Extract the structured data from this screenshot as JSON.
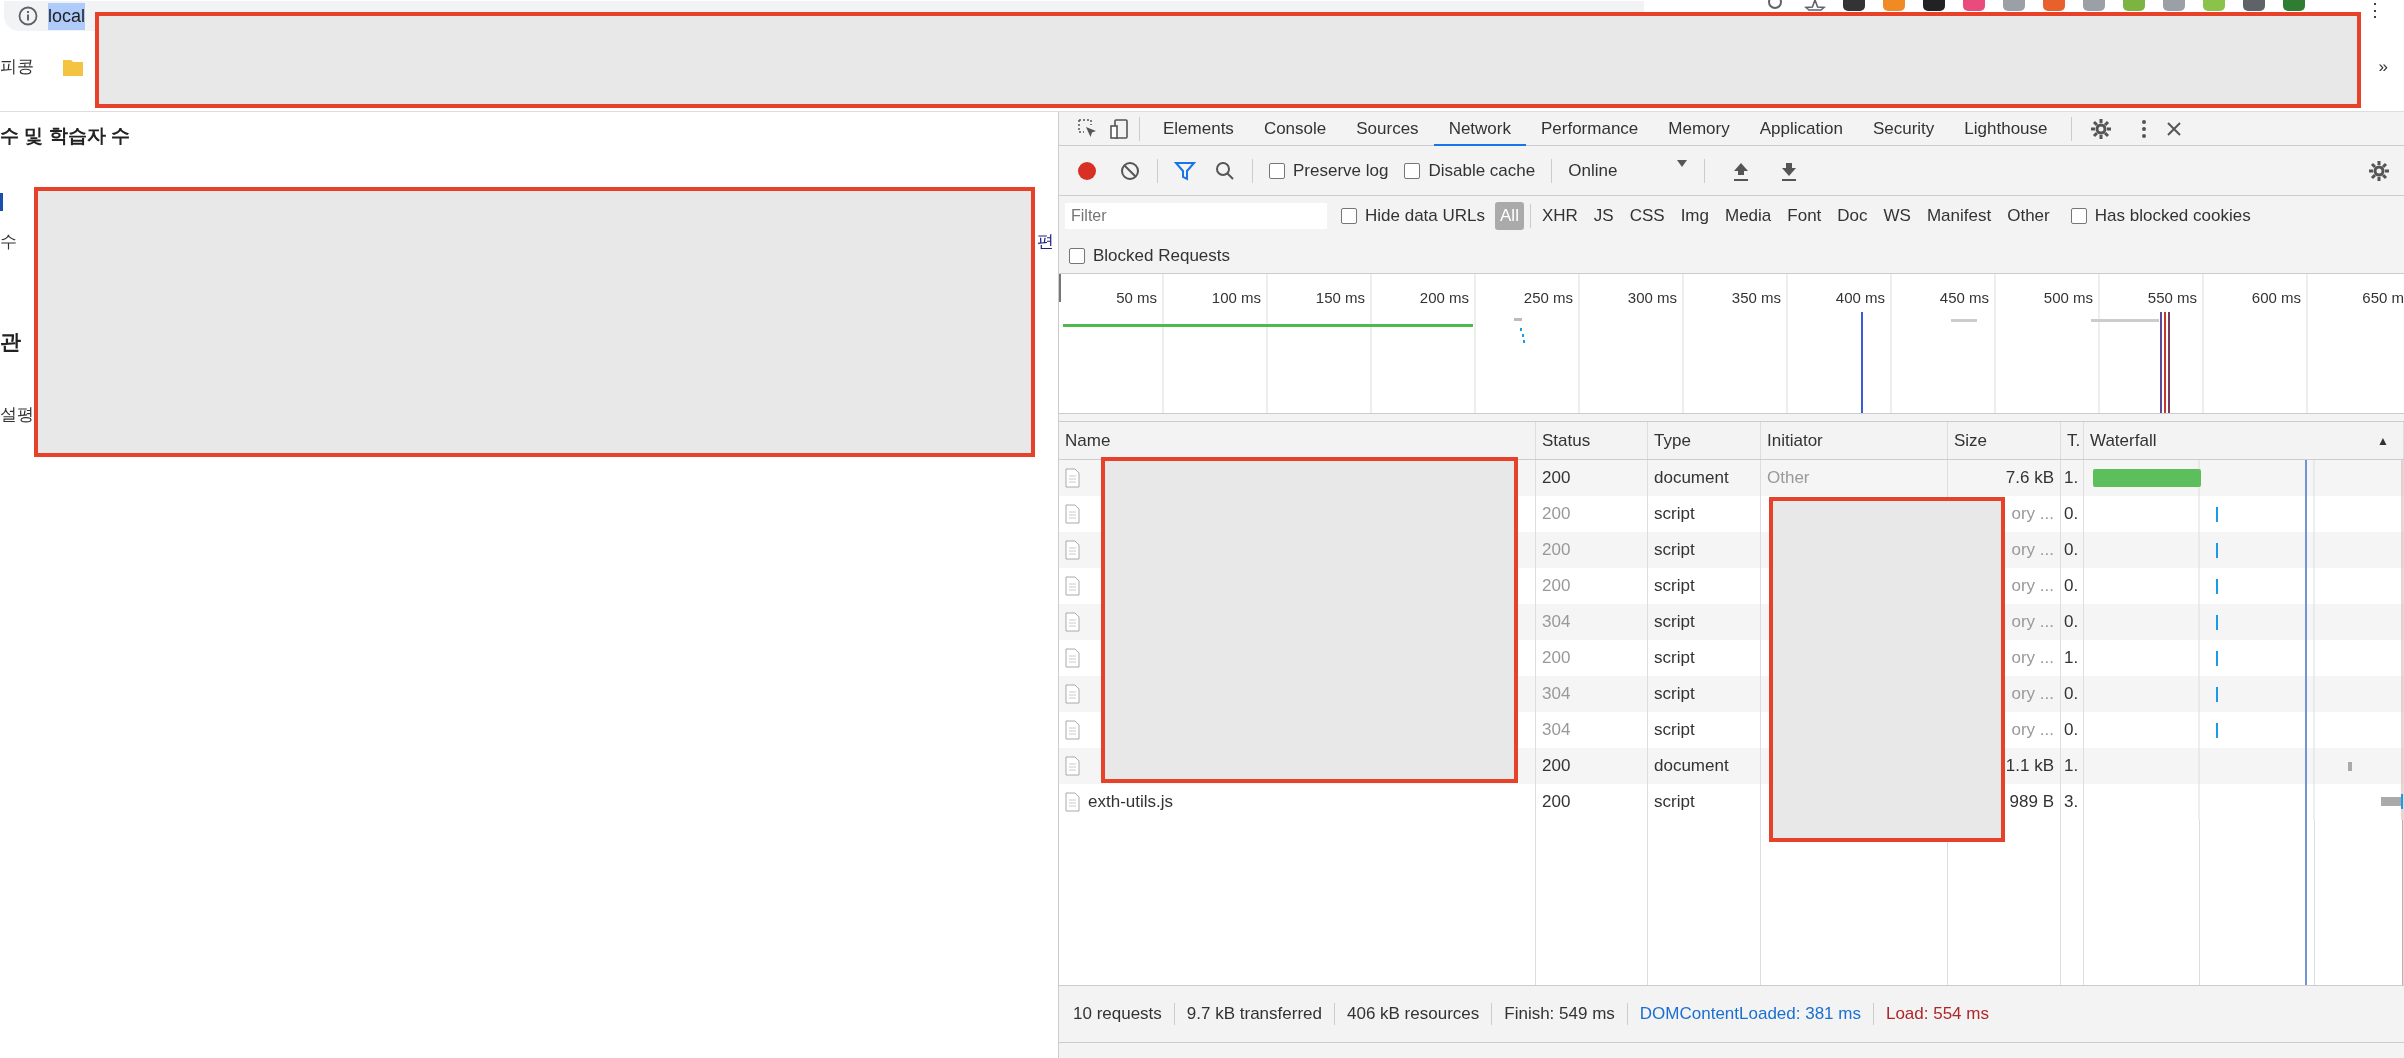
{
  "browser": {
    "url": "local",
    "bookmarks": [
      {
        "label": "피콩"
      }
    ],
    "bookmarks_more": "»",
    "menu": "⋮"
  },
  "page": {
    "texts": [
      {
        "kind": "heading",
        "text": "수 및 학습자 수"
      },
      {
        "kind": "marker"
      },
      {
        "kind": "row",
        "text": "수",
        "side_text": "편"
      },
      {
        "kind": "section",
        "text": "관"
      },
      {
        "kind": "plain",
        "text": "설평"
      }
    ]
  },
  "devtools": {
    "tabs": [
      {
        "label": "Elements",
        "selected": false
      },
      {
        "label": "Console",
        "selected": false
      },
      {
        "label": "Sources",
        "selected": false
      },
      {
        "label": "Network",
        "selected": true
      },
      {
        "label": "Performance",
        "selected": false
      },
      {
        "label": "Memory",
        "selected": false
      },
      {
        "label": "Application",
        "selected": false
      },
      {
        "label": "Security",
        "selected": false
      },
      {
        "label": "Lighthouse",
        "selected": false
      }
    ],
    "toolbar": {
      "recording": true,
      "preserve_log": {
        "label": "Preserve log",
        "checked": false
      },
      "disable_cache": {
        "label": "Disable cache",
        "checked": false
      },
      "throttling": "Online"
    },
    "filter": {
      "placeholder": "Filter",
      "hide_data_urls": {
        "label": "Hide data URLs",
        "checked": false
      },
      "types": [
        {
          "label": "All",
          "selected": true
        },
        {
          "label": "XHR",
          "selected": false
        },
        {
          "label": "JS",
          "selected": false
        },
        {
          "label": "CSS",
          "selected": false
        },
        {
          "label": "Img",
          "selected": false
        },
        {
          "label": "Media",
          "selected": false
        },
        {
          "label": "Font",
          "selected": false
        },
        {
          "label": "Doc",
          "selected": false
        },
        {
          "label": "WS",
          "selected": false
        },
        {
          "label": "Manifest",
          "selected": false
        },
        {
          "label": "Other",
          "selected": false
        }
      ],
      "has_blocked_cookies": {
        "label": "Has blocked cookies",
        "checked": false
      },
      "blocked_requests": {
        "label": "Blocked Requests",
        "checked": false
      }
    },
    "timeline": {
      "ticks": [
        "50 ms",
        "100 ms",
        "150 ms",
        "200 ms",
        "250 ms",
        "300 ms",
        "350 ms",
        "400 ms",
        "450 ms",
        "500 ms",
        "550 ms",
        "600 ms",
        "650 m"
      ]
    },
    "table": {
      "columns": [
        "Name",
        "Status",
        "Type",
        "Initiator",
        "Size",
        "T.",
        "Waterfall"
      ],
      "sort_indicator": "▲",
      "rows": [
        {
          "status": "200",
          "type": "document",
          "initiator": "Other",
          "size": "7.6 kB",
          "time": "1.",
          "from_cache": false
        },
        {
          "status": "200",
          "type": "script",
          "size": "ory ...",
          "time": "0.",
          "from_cache": true
        },
        {
          "status": "200",
          "type": "script",
          "size": "ory ...",
          "time": "0.",
          "from_cache": true
        },
        {
          "status": "200",
          "type": "script",
          "size": "ory ...",
          "time": "0.",
          "from_cache": true
        },
        {
          "status": "304",
          "type": "script",
          "size": "ory ...",
          "time": "0.",
          "from_cache": true
        },
        {
          "status": "200",
          "type": "script",
          "size": "ory ...",
          "time": "1.",
          "from_cache": true
        },
        {
          "status": "304",
          "type": "script",
          "size": "ory ...",
          "time": "0.",
          "from_cache": true
        },
        {
          "status": "304",
          "type": "script",
          "size": "ory ...",
          "time": "0.",
          "from_cache": true
        },
        {
          "status": "200",
          "type": "document",
          "size": "1.1 kB",
          "time": "1.",
          "from_cache": false
        },
        {
          "name": "exth-utils.js",
          "status": "200",
          "type": "script",
          "size": "989 B",
          "time": "3.",
          "from_cache": false
        }
      ]
    },
    "status_bar": [
      {
        "kind": "plain",
        "text": "10 requests"
      },
      {
        "kind": "plain",
        "text": "9.7 kB transferred"
      },
      {
        "kind": "plain",
        "text": "406 kB resources"
      },
      {
        "kind": "plain",
        "text": "Finish: 549 ms"
      },
      {
        "kind": "dcl",
        "text": "DOMContentLoaded: 381 ms"
      },
      {
        "kind": "load",
        "text": "Load: 554 ms"
      }
    ]
  }
}
